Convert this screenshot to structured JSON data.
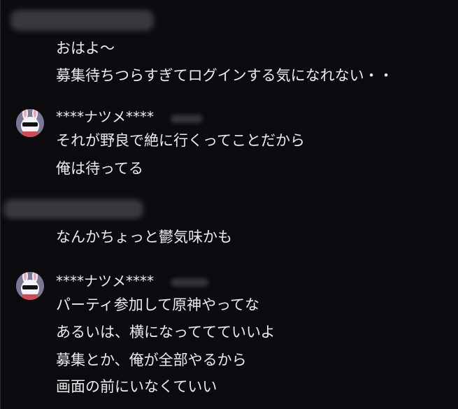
{
  "messages": [
    {
      "author": "",
      "lines": [
        "おはよ〜",
        "募集待ちつらすぎてログインする気になれない・・"
      ]
    },
    {
      "author": "****ナツメ****",
      "avatar_icon": "bunny-sunglasses-avatar",
      "lines": [
        "それが野良で絶に行くってことだから",
        "俺は待ってる"
      ]
    },
    {
      "author": "",
      "lines": [
        "なんかちょっと鬱気味かも"
      ]
    },
    {
      "author": "****ナツメ****",
      "avatar_icon": "bunny-sunglasses-avatar",
      "lines": [
        "パーティ参加して原神やってな",
        "あるいは、横になっててていいよ",
        "募集とか、俺が全部やるから",
        "画面の前にいなくていい"
      ]
    }
  ],
  "colors": {
    "background": "#0b0b0d",
    "text": "#ececf0",
    "redaction": "#3e3e43"
  }
}
